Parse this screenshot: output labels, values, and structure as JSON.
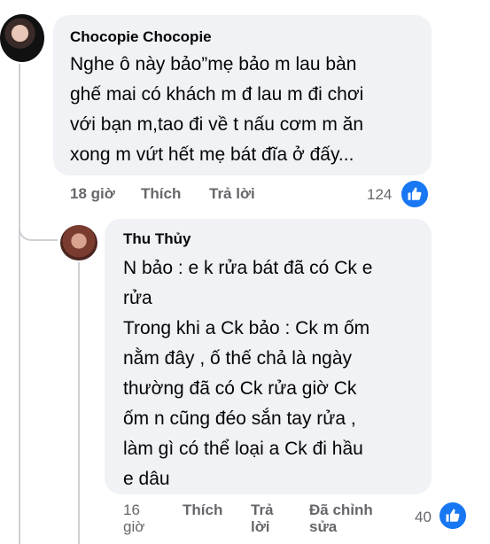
{
  "comment": {
    "author": "Chocopie Chocopie",
    "lines": [
      "Nghe ô này bảo”mẹ bảo m lau bàn",
      "ghế mai có khách m đ lau m đi chơi",
      "với bạn m,tao đi về t nấu cơm m ăn",
      "xong m vứt hết mẹ bát đĩa ở đấy..."
    ],
    "time": "18 giờ",
    "like_label": "Thích",
    "reply_label": "Trả lời",
    "reaction_count": "124"
  },
  "reply": {
    "author": "Thu Thủy",
    "lines": [
      "N bảo : e k rửa bát đã có Ck e",
      "rửa",
      "Trong khi a Ck bảo : Ck m ốm",
      "nằm đây , ố thế chả là ngày",
      "thường đã có Ck rửa giờ Ck",
      "ốm n cũng đéo sắn tay rửa ,",
      "làm gì có thể loại a Ck đi hầu",
      "e dâu"
    ],
    "time_lines": [
      "16",
      "giờ"
    ],
    "like_label": "Thích",
    "reply_lines": [
      "Trả",
      "lời"
    ],
    "edited_lines": [
      "Đã chỉnh",
      "sửa"
    ],
    "reaction_count": "40"
  },
  "colors": {
    "bubble": "#f0f2f5",
    "meta_text": "#65676b",
    "like_blue": "#1877f2",
    "thread_line": "#ced0d4"
  }
}
